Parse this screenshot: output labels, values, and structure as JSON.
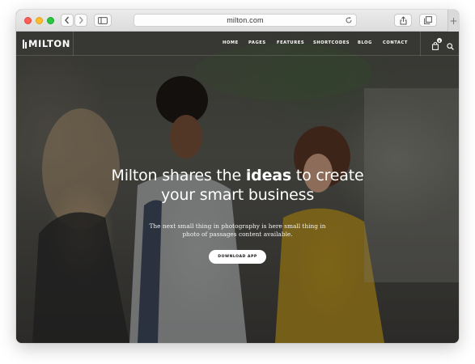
{
  "browser": {
    "url": "milton.com",
    "new_tab_label": "+"
  },
  "site": {
    "logo_text": "MILTON",
    "nav": [
      "HOME",
      "PAGES",
      "FEATURES",
      "SHORTCODES",
      "BLOG",
      "CONTACT"
    ],
    "cart_count": "0"
  },
  "hero": {
    "headline_before": "Milton shares the ",
    "headline_bold": "ideas",
    "headline_after": " to create",
    "headline_line2": "your smart business",
    "subtext_line1": "The next small thing in photography is here small thing in",
    "subtext_line2": "photo of passages content available.",
    "cta_label": "DOWNLOAD APP"
  },
  "colors": {
    "traffic_red": "#fc5f57",
    "traffic_yellow": "#fdbc2e",
    "traffic_green": "#28c840",
    "cta_background": "#ffffff"
  }
}
